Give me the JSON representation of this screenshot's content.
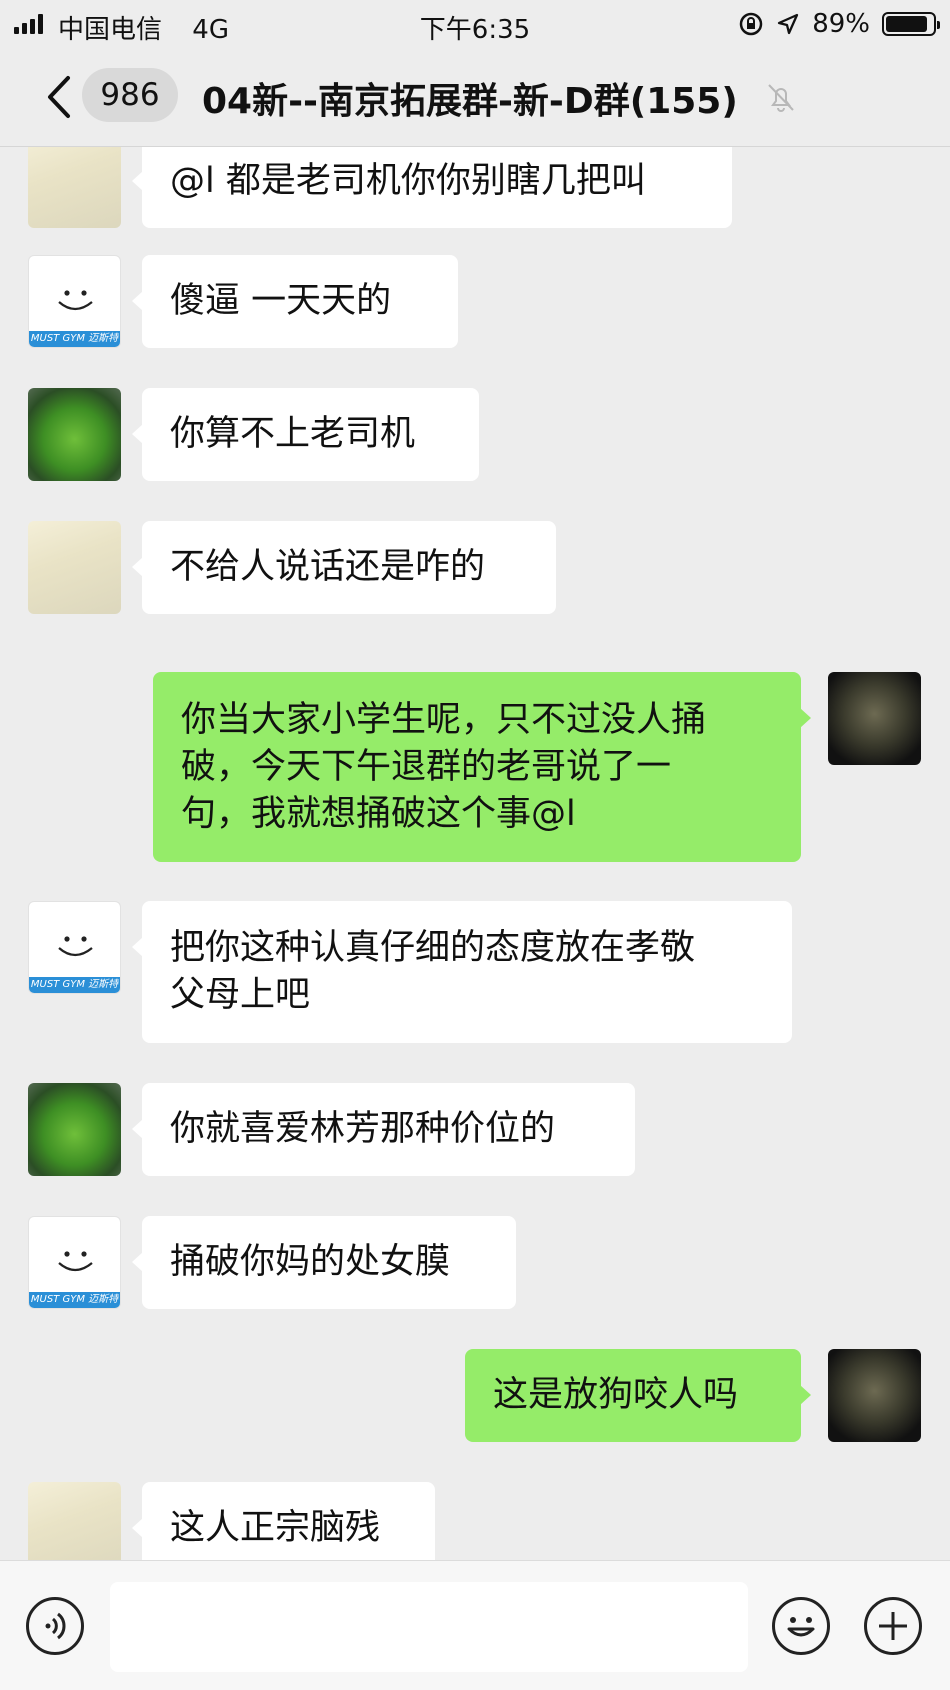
{
  "status_bar": {
    "carrier": "中国电信",
    "network": "4G",
    "time": "下午6:35",
    "battery": "89%",
    "battery_level": 0.89
  },
  "nav": {
    "unread_count": "986",
    "title": "04新--南京拓展群-新-D群(155)"
  },
  "messages": [
    {
      "side": "in",
      "avatar": "anime",
      "text": "@l 都是老司机你你别瞎几把叫"
    },
    {
      "side": "in",
      "avatar": "gym",
      "text": "傻逼 一天天的"
    },
    {
      "side": "in",
      "avatar": "plant",
      "text": "你算不上老司机"
    },
    {
      "side": "in",
      "avatar": "anime",
      "text": "不给人说话还是咋的"
    },
    {
      "side": "out",
      "avatar": "man",
      "text": "你当大家小学生呢，只不过没人捅\n破，今天下午退群的老哥说了一\n句，我就想捅破这个事@l"
    },
    {
      "side": "in",
      "avatar": "gym",
      "text": "把你这种认真仔细的态度放在孝敬\n父母上吧"
    },
    {
      "side": "in",
      "avatar": "plant",
      "text": "你就喜爱林芳那种价位的"
    },
    {
      "side": "in",
      "avatar": "gym",
      "text": "捅破你妈的处女膜"
    },
    {
      "side": "out",
      "avatar": "man",
      "text": "这是放狗咬人吗"
    },
    {
      "side": "in",
      "avatar": "anime",
      "text": "这人正宗脑残"
    }
  ],
  "gym_avatar_label": "MUST GYM 迈斯特"
}
